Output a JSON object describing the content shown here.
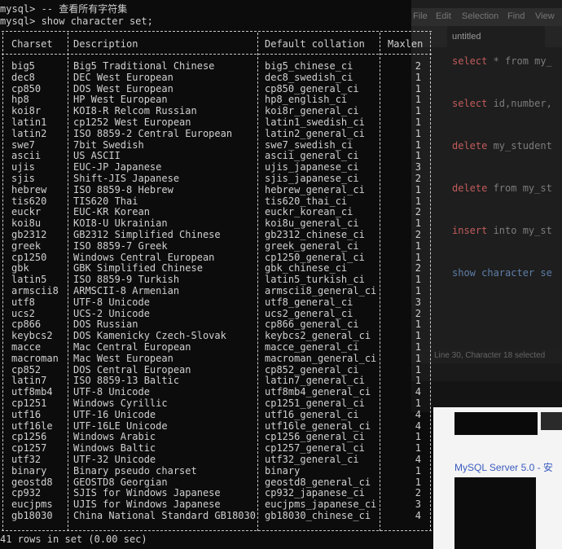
{
  "editor": {
    "menu": [
      "File",
      "Edit",
      "Selection",
      "Find",
      "View"
    ],
    "tab_label": "untitled",
    "lines": [
      {
        "kw": "select",
        "rest": " * from my_"
      },
      {
        "kw": "select",
        "rest": " id,number,"
      },
      {
        "kw": "delete",
        "rest": " my_student"
      },
      {
        "kw": "delete",
        "rest": " from my_st"
      },
      {
        "kw": "insert",
        "rest": " into my_st"
      },
      {
        "kw": "show",
        "rest": " character se"
      }
    ],
    "status_text": "Line 30, Character 18 selected"
  },
  "web": {
    "link_text": "MySQL Server 5.0 - 安"
  },
  "terminal": {
    "prompt1": "mysql> -- 查看所有字符集",
    "prompt2": "mysql> show character set;",
    "footer": "41 rows in set (0.00 sec)",
    "columns": [
      "Charset",
      "Description",
      "Default collation",
      "Maxlen"
    ],
    "rows": [
      [
        "big5",
        "Big5 Traditional Chinese",
        "big5_chinese_ci",
        "2"
      ],
      [
        "dec8",
        "DEC West European",
        "dec8_swedish_ci",
        "1"
      ],
      [
        "cp850",
        "DOS West European",
        "cp850_general_ci",
        "1"
      ],
      [
        "hp8",
        "HP West European",
        "hp8_english_ci",
        "1"
      ],
      [
        "koi8r",
        "KOI8-R Relcom Russian",
        "koi8r_general_ci",
        "1"
      ],
      [
        "latin1",
        "cp1252 West European",
        "latin1_swedish_ci",
        "1"
      ],
      [
        "latin2",
        "ISO 8859-2 Central European",
        "latin2_general_ci",
        "1"
      ],
      [
        "swe7",
        "7bit Swedish",
        "swe7_swedish_ci",
        "1"
      ],
      [
        "ascii",
        "US ASCII",
        "ascii_general_ci",
        "1"
      ],
      [
        "ujis",
        "EUC-JP Japanese",
        "ujis_japanese_ci",
        "3"
      ],
      [
        "sjis",
        "Shift-JIS Japanese",
        "sjis_japanese_ci",
        "2"
      ],
      [
        "hebrew",
        "ISO 8859-8 Hebrew",
        "hebrew_general_ci",
        "1"
      ],
      [
        "tis620",
        "TIS620 Thai",
        "tis620_thai_ci",
        "1"
      ],
      [
        "euckr",
        "EUC-KR Korean",
        "euckr_korean_ci",
        "2"
      ],
      [
        "koi8u",
        "KOI8-U Ukrainian",
        "koi8u_general_ci",
        "1"
      ],
      [
        "gb2312",
        "GB2312 Simplified Chinese",
        "gb2312_chinese_ci",
        "2"
      ],
      [
        "greek",
        "ISO 8859-7 Greek",
        "greek_general_ci",
        "1"
      ],
      [
        "cp1250",
        "Windows Central European",
        "cp1250_general_ci",
        "1"
      ],
      [
        "gbk",
        "GBK Simplified Chinese",
        "gbk_chinese_ci",
        "2"
      ],
      [
        "latin5",
        "ISO 8859-9 Turkish",
        "latin5_turkish_ci",
        "1"
      ],
      [
        "armscii8",
        "ARMSCII-8 Armenian",
        "armscii8_general_ci",
        "1"
      ],
      [
        "utf8",
        "UTF-8 Unicode",
        "utf8_general_ci",
        "3"
      ],
      [
        "ucs2",
        "UCS-2 Unicode",
        "ucs2_general_ci",
        "2"
      ],
      [
        "cp866",
        "DOS Russian",
        "cp866_general_ci",
        "1"
      ],
      [
        "keybcs2",
        "DOS Kamenicky Czech-Slovak",
        "keybcs2_general_ci",
        "1"
      ],
      [
        "macce",
        "Mac Central European",
        "macce_general_ci",
        "1"
      ],
      [
        "macroman",
        "Mac West European",
        "macroman_general_ci",
        "1"
      ],
      [
        "cp852",
        "DOS Central European",
        "cp852_general_ci",
        "1"
      ],
      [
        "latin7",
        "ISO 8859-13 Baltic",
        "latin7_general_ci",
        "1"
      ],
      [
        "utf8mb4",
        "UTF-8 Unicode",
        "utf8mb4_general_ci",
        "4"
      ],
      [
        "cp1251",
        "Windows Cyrillic",
        "cp1251_general_ci",
        "1"
      ],
      [
        "utf16",
        "UTF-16 Unicode",
        "utf16_general_ci",
        "4"
      ],
      [
        "utf16le",
        "UTF-16LE Unicode",
        "utf16le_general_ci",
        "4"
      ],
      [
        "cp1256",
        "Windows Arabic",
        "cp1256_general_ci",
        "1"
      ],
      [
        "cp1257",
        "Windows Baltic",
        "cp1257_general_ci",
        "1"
      ],
      [
        "utf32",
        "UTF-32 Unicode",
        "utf32_general_ci",
        "4"
      ],
      [
        "binary",
        "Binary pseudo charset",
        "binary",
        "1"
      ],
      [
        "geostd8",
        "GEOSTD8 Georgian",
        "geostd8_general_ci",
        "1"
      ],
      [
        "cp932",
        "SJIS for Windows Japanese",
        "cp932_japanese_ci",
        "2"
      ],
      [
        "eucjpms",
        "UJIS for Windows Japanese",
        "eucjpms_japanese_ci",
        "3"
      ],
      [
        "gb18030",
        "China National Standard GB18030",
        "gb18030_chinese_ci",
        "4"
      ]
    ]
  }
}
